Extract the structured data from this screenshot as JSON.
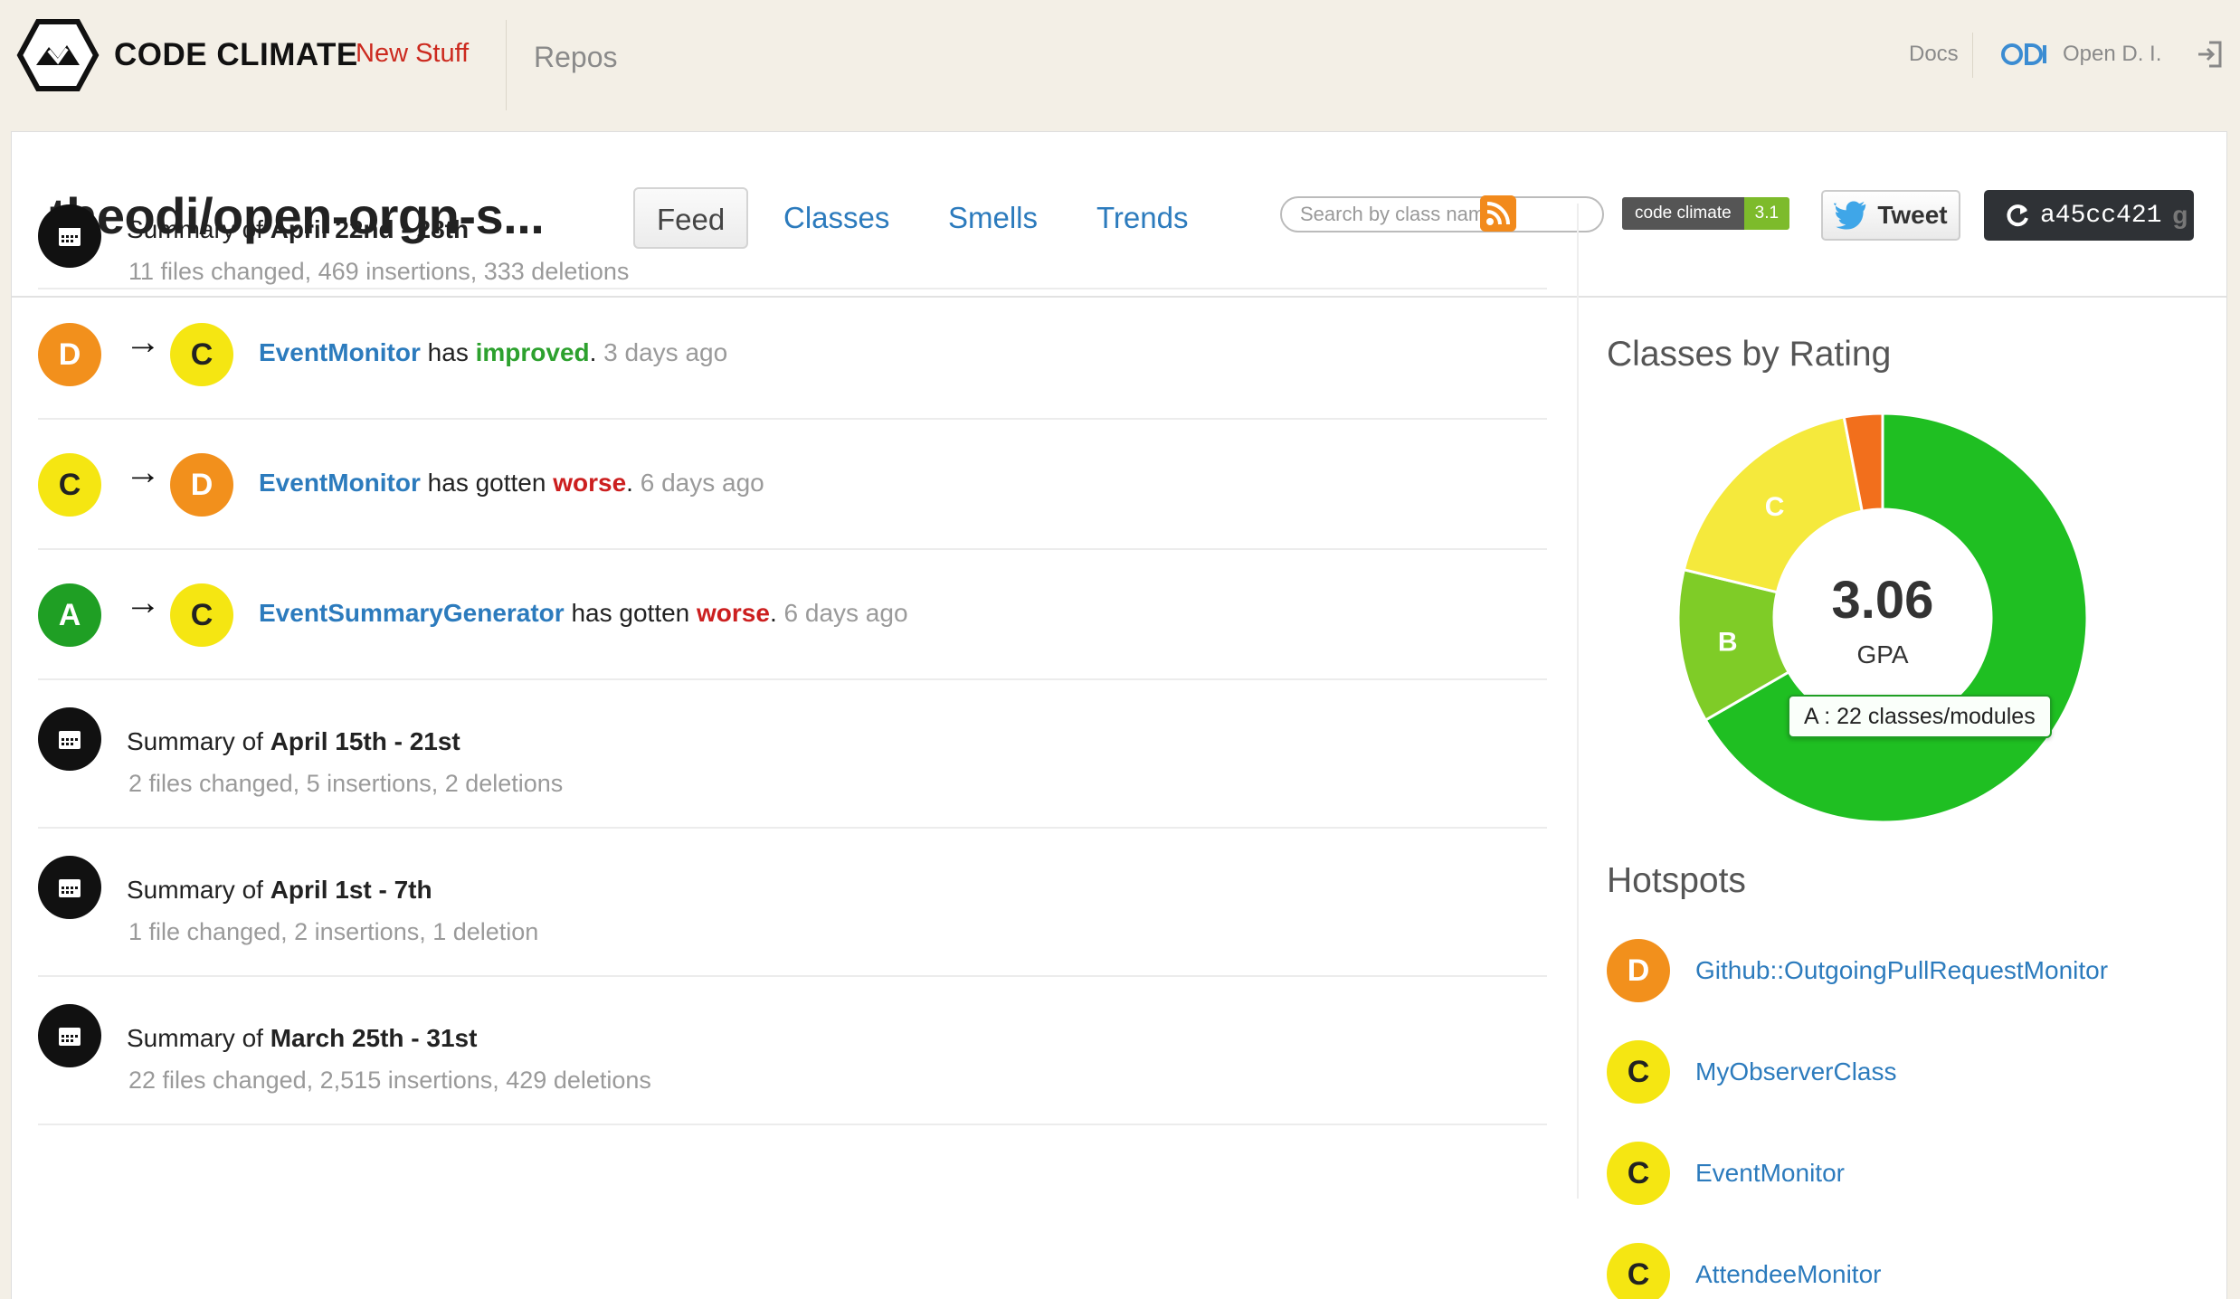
{
  "header": {
    "brand": "CODE CLIMATE",
    "new_stuff": "New Stuff",
    "repos": "Repos",
    "docs": "Docs",
    "user": "Open D. I."
  },
  "repo": {
    "title": "theodi/open-orgn-s...",
    "tabs": [
      "Feed",
      "Classes",
      "Smells",
      "Trends"
    ],
    "active_tab": "Feed",
    "search_placeholder": "Search by class name",
    "badge_label": "code climate",
    "badge_value": "3.1",
    "tweet_label": "Tweet",
    "commit": "a45cc421"
  },
  "feed": {
    "summaries": [
      {
        "prefix": "Summary of ",
        "range": "April 22nd - 28th",
        "stats": "11 files changed, 469 insertions, 333 deletions"
      },
      {
        "prefix": "Summary of ",
        "range": "April 15th - 21st",
        "stats": "2 files changed, 5 insertions, 2 deletions"
      },
      {
        "prefix": "Summary of ",
        "range": "April 1st - 7th",
        "stats": "1 file changed, 2 insertions, 1 deletion"
      },
      {
        "prefix": "Summary of ",
        "range": "March 25th - 31st",
        "stats": "22 files changed, 2,515 insertions, 429 deletions"
      }
    ],
    "changes": [
      {
        "from": "D",
        "to": "C",
        "class_name": "EventMonitor",
        "verb": " has ",
        "status": "improved",
        "time": " 3 days ago"
      },
      {
        "from": "C",
        "to": "D",
        "class_name": "EventMonitor",
        "verb": " has gotten ",
        "status": "worse",
        "time": " 6 days ago"
      },
      {
        "from": "A",
        "to": "C",
        "class_name": "EventSummaryGenerator",
        "verb": " has gotten ",
        "status": "worse",
        "time": " 6 days ago"
      }
    ],
    "arrow": "→"
  },
  "sidebar": {
    "rating_heading": "Classes by Rating",
    "gpa_value": "3.06",
    "gpa_label": "GPA",
    "tooltip": "A : 22 classes/modules",
    "hotspots_heading": "Hotspots",
    "hotspots": [
      {
        "grade": "D",
        "name": "Github::OutgoingPullRequestMonitor"
      },
      {
        "grade": "C",
        "name": "MyObserverClass"
      },
      {
        "grade": "C",
        "name": "EventMonitor"
      },
      {
        "grade": "C",
        "name": "AttendeeMonitor"
      }
    ]
  },
  "chart_data": {
    "type": "pie",
    "title": "Classes by Rating",
    "categories": [
      "A",
      "B",
      "C",
      "D"
    ],
    "values": [
      22,
      4,
      6,
      1
    ],
    "colors": {
      "A": "#1fbf22",
      "B": "#7fcc27",
      "C": "#f5e93c",
      "D": "#f26f1c"
    }
  }
}
